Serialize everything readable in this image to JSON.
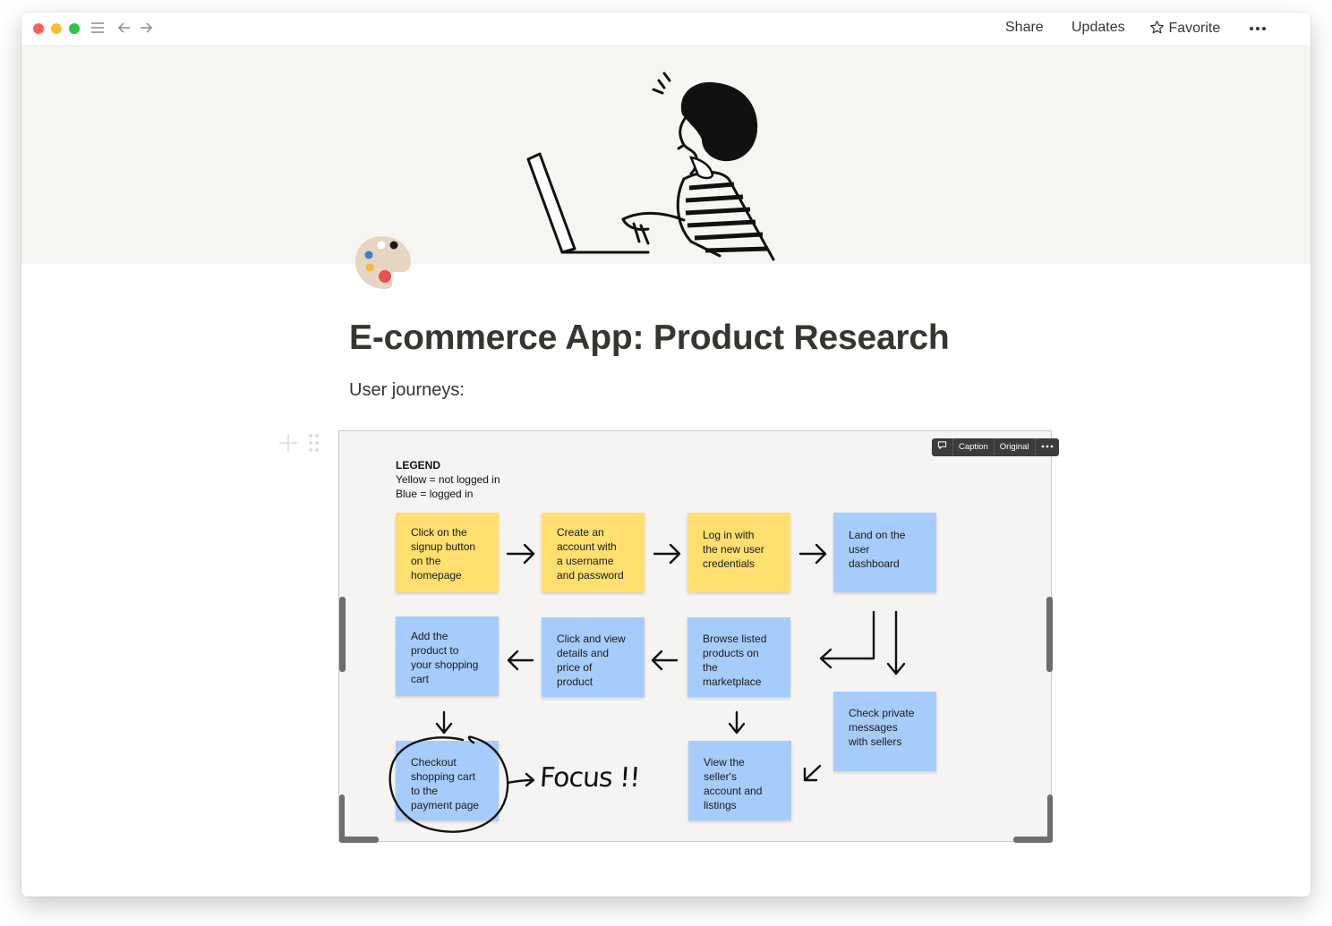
{
  "topbar": {
    "share_label": "Share",
    "updates_label": "Updates",
    "favorite_label": "Favorite"
  },
  "page": {
    "title": "E-commerce App: Product Research",
    "subtitle": "User journeys:"
  },
  "image_toolbar": {
    "caption_label": "Caption",
    "original_label": "Original"
  },
  "board": {
    "legend": {
      "heading": "LEGEND",
      "line1": "Yellow = not logged in",
      "line2": "Blue = logged in"
    },
    "colors": {
      "yellow": "#fedf6f",
      "blue": "#a6ccfc"
    },
    "stickies": [
      {
        "color": "yellow",
        "lines": [
          "Click on the",
          "signup button",
          "on the",
          "homepage"
        ]
      },
      {
        "color": "yellow",
        "lines": [
          "Create an",
          "account with",
          "a username",
          "and password"
        ]
      },
      {
        "color": "yellow",
        "lines": [
          "Log in with",
          "the new user",
          "credentials"
        ]
      },
      {
        "color": "blue",
        "lines": [
          "Land on the",
          "user",
          "dashboard"
        ]
      },
      {
        "color": "blue",
        "lines": [
          "Add the",
          "product to",
          "your shopping",
          "cart"
        ]
      },
      {
        "color": "blue",
        "lines": [
          "Click and view",
          "details and",
          "price of",
          "product"
        ]
      },
      {
        "color": "blue",
        "lines": [
          "Browse listed",
          "products on",
          "the",
          "marketplace"
        ]
      },
      {
        "color": "blue",
        "lines": [
          "Check private",
          "messages",
          "with sellers"
        ]
      },
      {
        "color": "blue",
        "lines": [
          "Checkout",
          "shopping cart",
          "to the",
          "payment page"
        ]
      },
      {
        "color": "blue",
        "lines": [
          "View the",
          "seller's",
          "account and",
          "listings"
        ]
      }
    ],
    "annotation": "Focus !!"
  }
}
